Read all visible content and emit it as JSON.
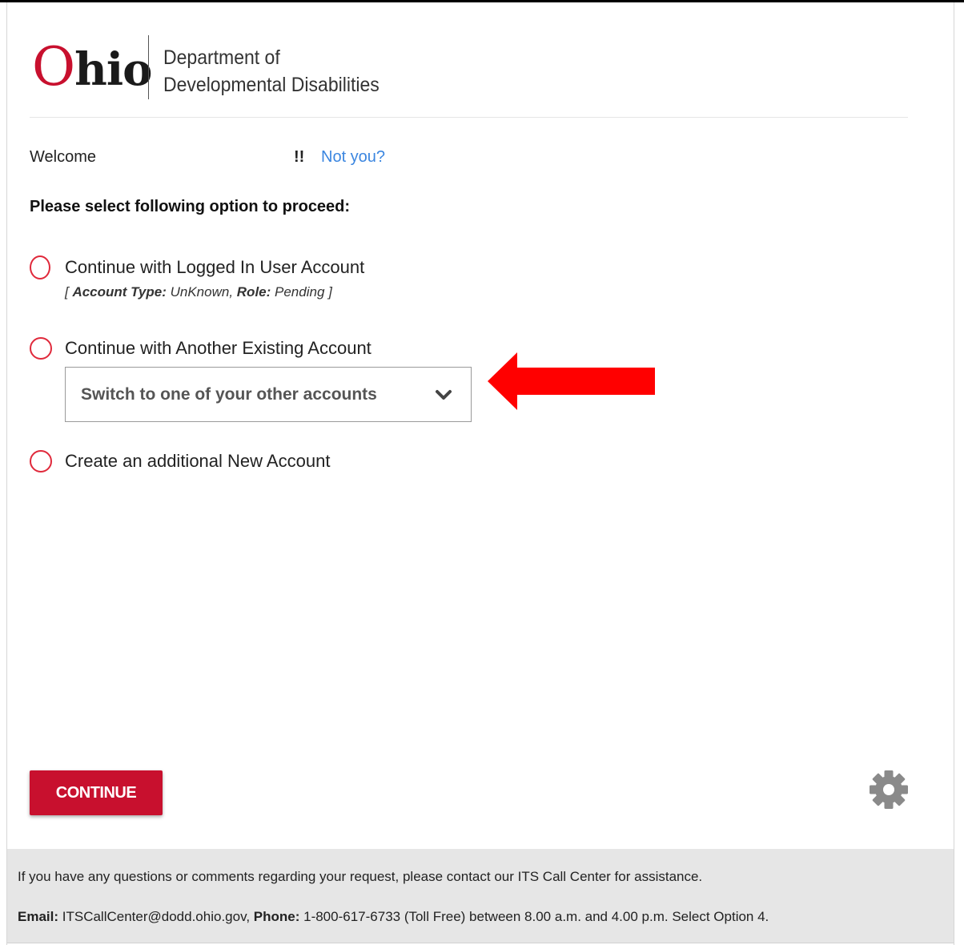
{
  "logo": {
    "state_initial": "O",
    "state_rest": "hio",
    "dept_line1": "Department of",
    "dept_line2": "Developmental Disabilities"
  },
  "welcome": {
    "label": "Welcome",
    "exclaim": "!!",
    "not_you_link": "Not you?"
  },
  "instruction": "Please select following option to proceed:",
  "options": [
    {
      "label": "Continue with Logged In User Account",
      "detail": {
        "open": "[ ",
        "account_type_label": "Account Type:",
        "account_type_value": " UnKnown, ",
        "role_label": "Role:",
        "role_value": " Pending ]"
      }
    },
    {
      "label": "Continue with Another Existing Account"
    },
    {
      "label": "Create an additional New Account"
    }
  ],
  "dropdown": {
    "selected": "Switch to one of your other accounts"
  },
  "continue_label": "CONTINUE",
  "footer": {
    "line1": "If you have any questions or comments regarding your request, please contact our ITS Call Center for assistance.",
    "email_label": "Email:",
    "email_value": " ITSCallCenter@dodd.ohio.gov,  ",
    "phone_label": "Phone:",
    "phone_value": " 1-800-617-6733 (Toll Free) between 8.00 a.m. and 4.00 p.m. Select Option 4."
  },
  "colors": {
    "brand_red": "#c8102e",
    "link_blue": "#3b86e0",
    "radio_red": "#e0293b",
    "annotation_arrow": "#ff0000"
  },
  "icons": {
    "dropdown": "chevron-down-icon",
    "settings": "gear-icon",
    "annotation": "left-arrow-icon"
  }
}
